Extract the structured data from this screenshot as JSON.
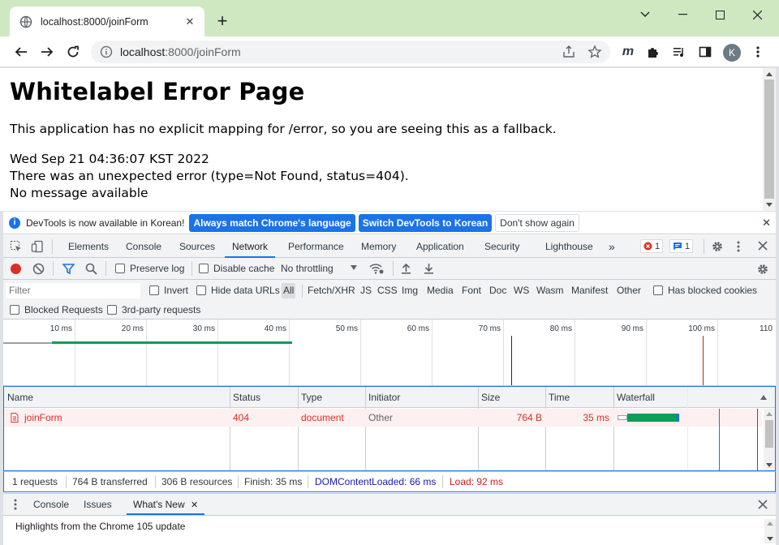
{
  "browser": {
    "tab_title": "localhost:8000/joinForm",
    "url_host": "localhost",
    "url_rest": ":8000/joinForm",
    "profile_initial": "K"
  },
  "page": {
    "heading": "Whitelabel Error Page",
    "message": "This application has no explicit mapping for /error, so you are seeing this as a fallback.",
    "timestamp": "Wed Sep 21 04:36:07 KST 2022",
    "error_line": "There was an unexpected error (type=Not Found, status=404).",
    "detail": "No message available"
  },
  "infobar": {
    "text": "DevTools is now available in Korean!",
    "btn_match": "Always match Chrome's language",
    "btn_switch": "Switch DevTools to Korean",
    "btn_dismiss": "Don't show again"
  },
  "devtools_tabs": [
    "Elements",
    "Console",
    "Sources",
    "Network",
    "Performance",
    "Memory",
    "Application",
    "Security",
    "Lighthouse"
  ],
  "active_tab": "Network",
  "badges": {
    "errors": "1",
    "messages": "1"
  },
  "network_toolbar": {
    "preserve_log": "Preserve log",
    "disable_cache": "Disable cache",
    "throttling": "No throttling"
  },
  "filter": {
    "placeholder": "Filter",
    "invert": "Invert",
    "hide_data_urls": "Hide data URLs",
    "types": [
      "All",
      "Fetch/XHR",
      "JS",
      "CSS",
      "Img",
      "Media",
      "Font",
      "Doc",
      "WS",
      "Wasm",
      "Manifest",
      "Other"
    ],
    "has_blocked_cookies": "Has blocked cookies",
    "blocked_requests": "Blocked Requests",
    "third_party": "3rd-party requests"
  },
  "overview_ticks": [
    "10 ms",
    "20 ms",
    "30 ms",
    "40 ms",
    "50 ms",
    "60 ms",
    "70 ms",
    "80 ms",
    "90 ms",
    "100 ms",
    "110"
  ],
  "table": {
    "headers": {
      "name": "Name",
      "status": "Status",
      "type": "Type",
      "initiator": "Initiator",
      "size": "Size",
      "time": "Time",
      "waterfall": "Waterfall"
    },
    "rows": [
      {
        "name": "joinForm",
        "status": "404",
        "type": "document",
        "initiator": "Other",
        "size": "764 B",
        "time": "35 ms"
      }
    ]
  },
  "summary": {
    "requests": "1 requests",
    "transferred": "764 B transferred",
    "resources": "306 B resources",
    "finish": "Finish: 35 ms",
    "dcl": "DOMContentLoaded: 66 ms",
    "load": "Load: 92 ms"
  },
  "drawer": {
    "tabs": [
      "Console",
      "Issues",
      "What's New"
    ],
    "active": "What's New",
    "highlight": "Highlights from the Chrome 105 update"
  },
  "colors": {
    "accent": "#1a73e8",
    "error": "#d93025",
    "dcl_line": "#1a1aa6",
    "load_line": "#c5221f",
    "waterfall_bar": "#0f9d58",
    "titlebar": "#cfe8c2"
  }
}
